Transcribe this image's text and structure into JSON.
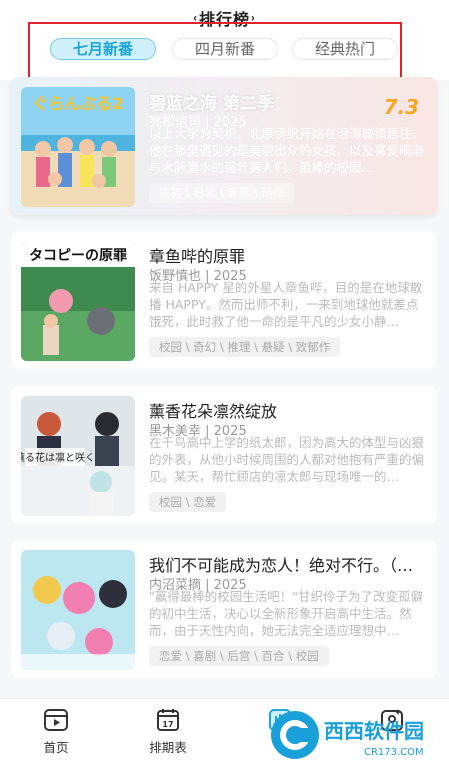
{
  "header": {
    "title": "排行榜",
    "tabs": [
      {
        "label": "七月新番",
        "active": true
      },
      {
        "label": "四月新番",
        "active": false
      },
      {
        "label": "经典热门",
        "active": false
      }
    ]
  },
  "items": [
    {
      "name": "碧蓝之海 第二季",
      "meta": "亮松信司 | 2025",
      "description": "以上大学为契机，北原伊织开始在沿海城镇居住。他在那里遇见的是美貌出众的女孩，以及喜爱喝酒与水肺潜水的强壮男人们。最棒的校园…",
      "tags": "搞笑 \\ 日常 \\ 青春 \\ 动作",
      "score": "7.3"
    },
    {
      "name": "章鱼哔的原罪",
      "meta": "饭野慎也 | 2025",
      "description": "来自 HAPPY 星的外星人章鱼哔，目的是在地球散播 HAPPY。然而出师不利，一来到地球他就差点饿死，此时救了他一命的是平凡的少女小静…",
      "tags": "校园 \\ 奇幻 \\ 推理 \\ 悬疑 \\ 致郁作"
    },
    {
      "name": "薰香花朵凛然绽放",
      "meta": "黑木美幸 | 2025",
      "description": "在千鸟高中上学的纸太郎，因为高大的体型与凶狠的外表，从他小时候周围的人都对他抱有严重的偏见。某天，帮忙顾店的凛太郎与现场唯一的…",
      "tags": "校园 \\ 恋爱"
    },
    {
      "name": "我们不可能成为恋人！绝对不行。（…",
      "meta": "内沼菜摘 | 2025",
      "description": "\"赢得最棒的校园生活吧！\"甘织伶子为了改变孤僻的初中生活，决心以全新形象开启高中生活。然而，由于天性内向，她无法完全适应理想中…",
      "tags": "恋爱 \\ 喜剧 \\ 后宫 \\ 百合 \\ 校园"
    }
  ],
  "tabbar": {
    "items": [
      {
        "label": "首页",
        "icon": "play-square-icon"
      },
      {
        "label": "排期表",
        "icon": "calendar-icon"
      },
      {
        "label": "",
        "icon": "ranking-icon"
      },
      {
        "label": "",
        "icon": "profile-icon"
      }
    ]
  },
  "watermark": {
    "text": "西西软件园",
    "url": "CR173.COM"
  },
  "colors": {
    "accent": "#1aa6d6",
    "score": "#f5a623",
    "highlight_box": "#e0242b"
  }
}
